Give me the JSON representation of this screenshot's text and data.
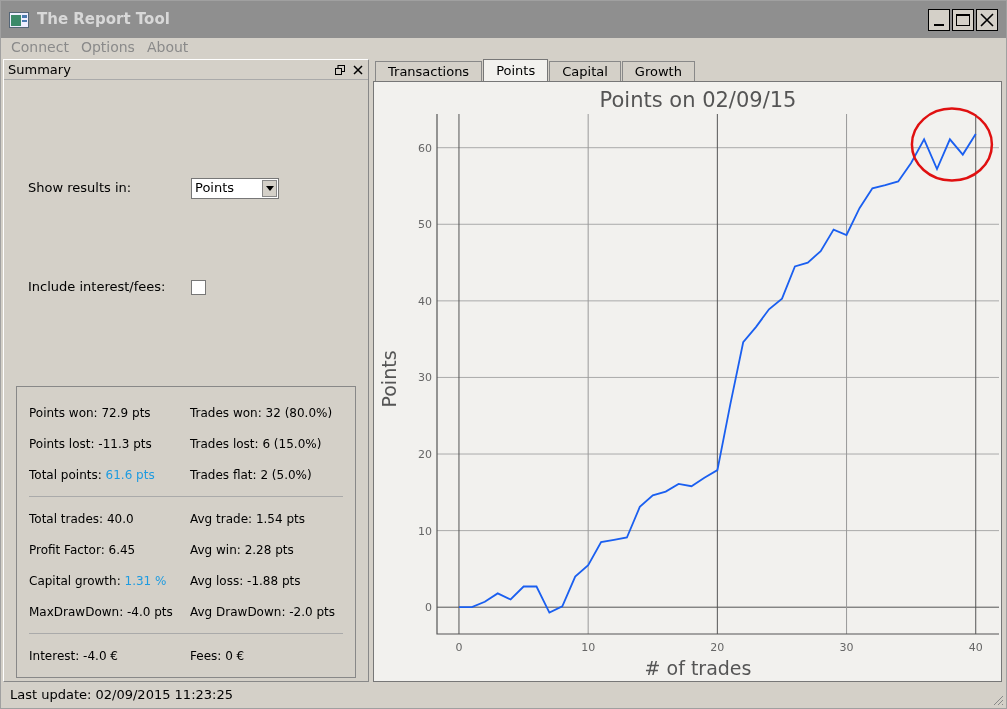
{
  "window": {
    "title": "The Report Tool"
  },
  "menu": [
    "Connect",
    "Options",
    "About"
  ],
  "summary": {
    "title": "Summary",
    "show_results": {
      "label": "Show results in:",
      "value": "Points"
    },
    "include_fees": {
      "label": "Include interest/fees:",
      "checked": false
    },
    "groups": [
      [
        [
          {
            "label": "Points won:",
            "value": "72.9 pts",
            "highlight": false
          },
          {
            "label": "Trades won:",
            "value": "32 (80.0%)",
            "highlight": false
          }
        ],
        [
          {
            "label": "Points lost:",
            "value": "-11.3 pts",
            "highlight": false
          },
          {
            "label": "Trades lost:",
            "value": "6 (15.0%)",
            "highlight": false
          }
        ],
        [
          {
            "label": "Total points:",
            "value": "61.6 pts",
            "highlight": true
          },
          {
            "label": "Trades flat:",
            "value": "2 (5.0%)",
            "highlight": false
          }
        ]
      ],
      [
        [
          {
            "label": "Total trades:",
            "value": "40.0",
            "highlight": false
          },
          {
            "label": "Avg trade:",
            "value": "1.54 pts",
            "highlight": false
          }
        ],
        [
          {
            "label": "Profit Factor:",
            "value": "6.45",
            "highlight": false
          },
          {
            "label": "Avg win:",
            "value": "2.28 pts",
            "highlight": false
          }
        ],
        [
          {
            "label": "Capital growth:",
            "value": "1.31 %",
            "highlight": true
          },
          {
            "label": "Avg loss:",
            "value": "-1.88 pts",
            "highlight": false
          }
        ],
        [
          {
            "label": "MaxDrawDown:",
            "value": "-4.0 pts",
            "highlight": false
          },
          {
            "label": "Avg DrawDown:",
            "value": "-2.0 pts",
            "highlight": false
          }
        ]
      ],
      [
        [
          {
            "label": "Interest:",
            "value": "-4.0 €",
            "highlight": false
          },
          {
            "label": "Fees:",
            "value": "0 €",
            "highlight": false
          }
        ]
      ]
    ]
  },
  "tabs": [
    {
      "label": "Transactions",
      "selected": false
    },
    {
      "label": "Points",
      "selected": true
    },
    {
      "label": "Capital",
      "selected": false
    },
    {
      "label": "Growth",
      "selected": false
    }
  ],
  "chart_data": {
    "type": "line",
    "title": "Points on 02/09/15",
    "xlabel": "# of trades",
    "ylabel": "Points",
    "x": [
      0,
      1,
      2,
      3,
      4,
      5,
      6,
      7,
      8,
      9,
      10,
      11,
      12,
      13,
      14,
      15,
      16,
      17,
      18,
      19,
      20,
      21,
      22,
      23,
      24,
      25,
      26,
      27,
      28,
      29,
      30,
      31,
      32,
      33,
      34,
      35,
      36,
      37,
      38,
      39,
      40
    ],
    "series": [
      {
        "color": "#1a5ff0",
        "values": [
          0,
          0,
          0.7,
          1.8,
          1.0,
          2.7,
          2.7,
          -0.7,
          0.1,
          4.0,
          5.5,
          8.5,
          8.8,
          9.1,
          13.1,
          14.6,
          15.1,
          16.1,
          15.8,
          16.9,
          17.9,
          26.5,
          34.6,
          36.6,
          38.9,
          40.3,
          44.5,
          45.0,
          46.5,
          49.3,
          48.6,
          52.1,
          54.7,
          55.1,
          55.6,
          58.0,
          61.1,
          57.2,
          61.1,
          59.1,
          61.8
        ]
      }
    ],
    "xlim": [
      -1.7,
      41.8
    ],
    "ylim": [
      -3.5,
      64.4
    ],
    "xticks": [
      0,
      10,
      20,
      30,
      40
    ],
    "yticks": [
      0,
      10,
      20,
      30,
      40,
      50,
      60
    ],
    "grid": true
  },
  "markup": [
    {
      "kind": "circle",
      "color": "#e01010"
    }
  ],
  "status_bar": {
    "text": "Last update: 02/09/2015 11:23:25"
  }
}
